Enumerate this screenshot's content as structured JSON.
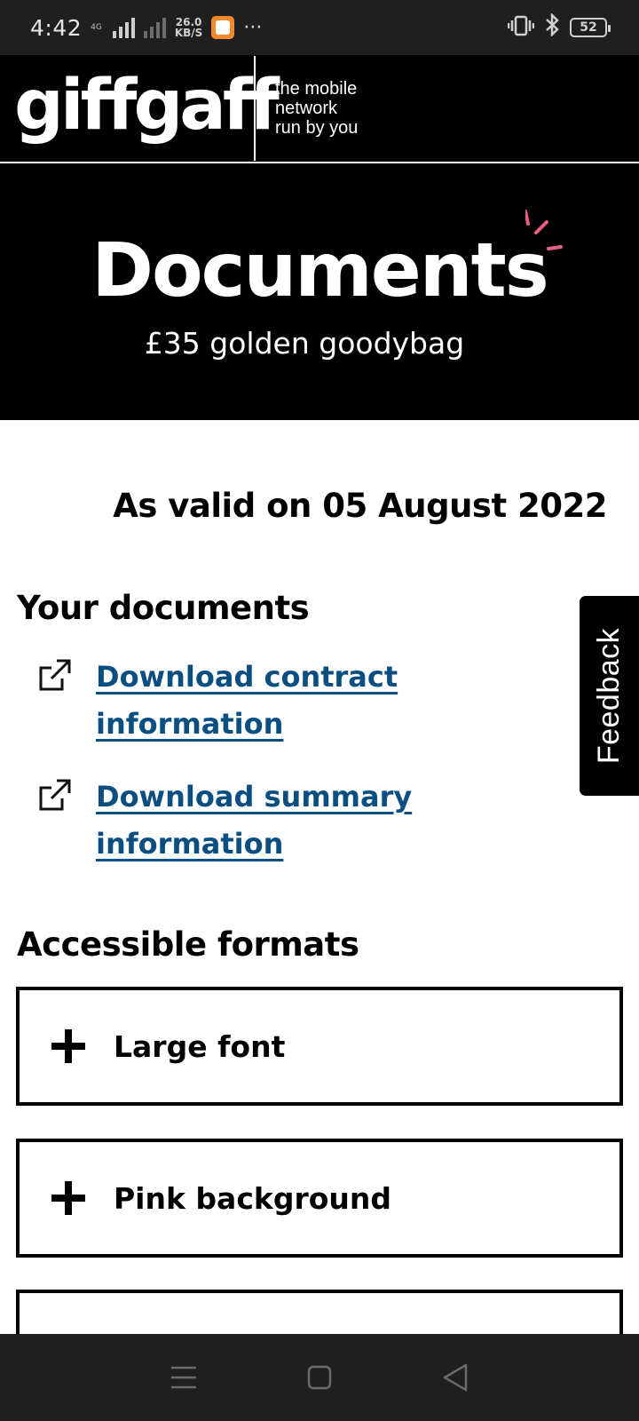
{
  "status_bar": {
    "time": "4:42",
    "network_type": "4G",
    "speed_value": "26.0",
    "speed_unit": "KB/S",
    "more": "···",
    "battery": "52"
  },
  "brand": {
    "logo_text": "giffgaff",
    "tagline_line1": "the mobile",
    "tagline_line2": "network",
    "tagline_line3": "run by you"
  },
  "hero": {
    "title": "Documents",
    "subtitle": "£35 golden goodybag",
    "sparkle_color": "#e8607f"
  },
  "main": {
    "valid_text": "As valid on 05 August 2022",
    "documents_heading": "Your documents",
    "links": [
      {
        "label": "Download contract information"
      },
      {
        "label": "Download summary information"
      }
    ],
    "link_color": "#0b4f82",
    "formats_heading": "Accessible formats",
    "formats": [
      {
        "label": "Large font"
      },
      {
        "label": "Pink background"
      },
      {
        "label": ""
      }
    ]
  },
  "feedback": {
    "label": "Feedback"
  },
  "nav": {
    "menu_icon": "menu-icon",
    "home_icon": "home-square-icon",
    "back_icon": "back-triangle-icon"
  }
}
